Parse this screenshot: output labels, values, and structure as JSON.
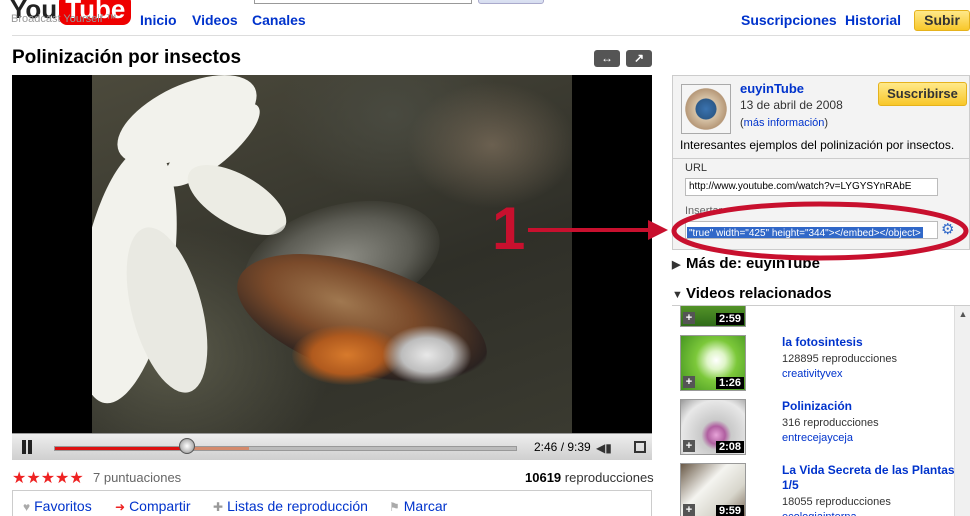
{
  "header": {
    "logo_you": "You",
    "logo_tube": "Tube",
    "tagline": "Broadcast Yourself ™",
    "nav_left": [
      "Inicio",
      "Videos",
      "Canales"
    ],
    "nav_right": [
      "Suscripciones",
      "Historial"
    ],
    "upload_label": "Subir"
  },
  "video": {
    "title": "Polinización por insectos",
    "time": "2:46 / 9:39",
    "progress_played_fraction": 0.287,
    "progress_loaded_fraction": 0.42,
    "rating_stars": "★★★★★",
    "ratings_count": "7 puntuaciones",
    "views_number": "10619",
    "views_label": "reproducciones"
  },
  "actions": {
    "favoritos": "Favoritos",
    "compartir": "Compartir",
    "listas": "Listas de reproducción",
    "marcar": "Marcar"
  },
  "channel": {
    "name": "euyinTube",
    "date": "13 de abril de 2008",
    "more_open": "(",
    "more_link": "más información",
    "more_close": ")",
    "subscribe_label": "Suscribirse",
    "description": "Interesantes ejemplos del polinización por insectos.",
    "url_label": "URL",
    "url_value": "http://www.youtube.com/watch?v=LYGYSYnRAbE",
    "embed_label": "Insertar",
    "embed_value": "\"true\" width=\"425\" height=\"344\"></embed></object>"
  },
  "sections": {
    "more_from": "Más de: euyinTube",
    "related": "Videos relacionados"
  },
  "related": [
    {
      "title": "",
      "views": "",
      "user": "",
      "duration": "2:59",
      "thumb": "green-field"
    },
    {
      "title": "la fotosintesis",
      "views": "128895 reproducciones",
      "user": "creativityvex",
      "duration": "1:26",
      "thumb": "green-leaf"
    },
    {
      "title": "Polinización",
      "views": "316 reproducciones",
      "user": "entrecejayceja",
      "duration": "2:08",
      "thumb": "flower"
    },
    {
      "title": "La Vida Secreta de las Plantas 1/5",
      "views": "18055 reproducciones",
      "user": "ecologiainterna",
      "duration": "9:59",
      "thumb": "white"
    }
  ],
  "annotation": {
    "number": "1",
    "color": "#c8102e"
  },
  "colors": {
    "link": "#0033cc",
    "brand_red": "#ee0000",
    "button_yellow": "#f8c72a",
    "selection_blue": "#3168c8"
  }
}
